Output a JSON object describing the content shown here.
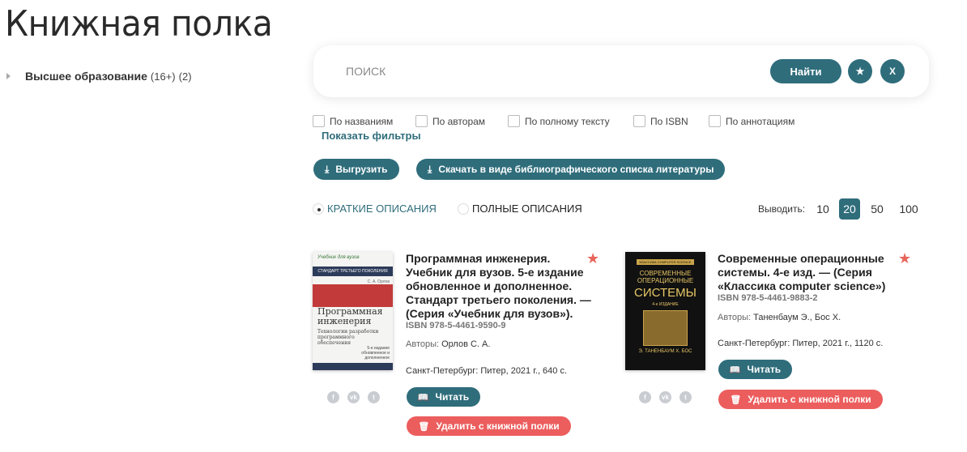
{
  "page": {
    "title": "Книжная полка"
  },
  "categories": [
    {
      "name": "Высшее образование",
      "age": "(16+)",
      "count": "(2)"
    }
  ],
  "search": {
    "placeholder": "ПОИСК",
    "find_label": "Найти",
    "fav_icon": "★",
    "clear_icon": "X"
  },
  "filters": {
    "by_title": "По названиям",
    "by_author": "По авторам",
    "by_fulltext": "По полному тексту",
    "by_isbn": "По ISBN",
    "by_annotation": "По аннотациям",
    "show_filters": "Показать фильтры"
  },
  "actions": {
    "export": "Выгрузить",
    "download_biblio": "Скачать в виде библиографического списка литературы"
  },
  "view": {
    "short": "КРАТКИЕ ОПИСАНИЯ",
    "full": "ПОЛНЫЕ ОПИСАНИЯ"
  },
  "per_page": {
    "label": "Выводить:",
    "options": [
      "10",
      "20",
      "50",
      "100"
    ],
    "selected": "20"
  },
  "books": [
    {
      "title": "Программная инженерия. Учебник для вузов. 5-е издание обновленное и дополненное. Стандарт третьего поколения. — (Серия «Учебник для вузов»).",
      "isbn": "ISBN 978-5-4461-9590-9",
      "authors_label": "Авторы:",
      "authors": "Орлов С. А.",
      "publication": "Санкт-Петербург: Питер, 2021 г., 640 с.",
      "read_label": "Читать",
      "delete_label": "Удалить с книжной полки",
      "cover": {
        "series": "Учебник для вузов",
        "standard": "СТАНДАРТ ТРЕТЬЕГО ПОКОЛЕНИЯ",
        "author": "С. А. Орлов",
        "title": "Программная инженерия",
        "subtitle": "Технологии разработки программного обеспечения",
        "edition": "5-е издание обновленное и дополненное"
      }
    },
    {
      "title": "Современные операционные системы. 4-е изд. — (Серия «Классика computer science»)",
      "isbn": "ISBN 978-5-4461-9883-2",
      "authors_label": "Авторы:",
      "authors": "Таненбаум Э., Бос Х.",
      "publication": "Санкт-Петербург: Питер, 2021 г., 1120 с.",
      "read_label": "Читать",
      "delete_label": "Удалить с книжной полки",
      "cover": {
        "series": "КЛАССИКА COMPUTER SCIENCE",
        "title_top": "СОВРЕМЕННЫЕ ОПЕРАЦИОННЫЕ",
        "title_main": "СИСТЕМЫ",
        "edition": "4-е ИЗДАНИЕ",
        "authors": "Э. ТАНЕНБАУМ Х. БОС"
      }
    }
  ],
  "colors": {
    "accent": "#2f6d7b",
    "danger": "#ec5d5d",
    "star": "#e8655a"
  }
}
